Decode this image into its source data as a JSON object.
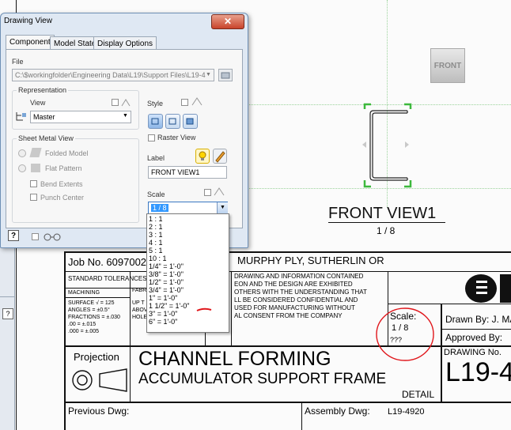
{
  "dialog": {
    "title": "Drawing View",
    "close_label": "✕",
    "tabs": [
      {
        "label": "Component"
      },
      {
        "label": "Model State"
      },
      {
        "label": "Display Options"
      }
    ],
    "file_label": "File",
    "file_path": "C:\\$workingfolder\\Engineering Data\\L19\\Support Files\\L19-4",
    "representation": {
      "group_label": "Representation",
      "view_label": "View",
      "view_value": "Master"
    },
    "sheet_metal": {
      "group_label": "Sheet Metal View",
      "folded": "Folded Model",
      "flat": "Flat Pattern",
      "bend": "Bend Extents",
      "punch": "Punch Center"
    },
    "style_label": "Style",
    "raster_label": "Raster View",
    "label_label": "Label",
    "label_value": "FRONT VIEW1",
    "scale_label": "Scale",
    "scale_value": "1 / 8",
    "help_label": "?",
    "scale_options": [
      "1 : 1",
      "2 : 1",
      "3 : 1",
      "4 : 1",
      "5 : 1",
      "10 : 1",
      "1/4\" = 1'-0\"",
      "3/8\" = 1'-0\"",
      "1/2\" = 1'-0\"",
      "3/4\" = 1'-0\"",
      "1\" = 1'-0\"",
      "1 1/2\" = 1'-0\"",
      "3\" = 1'-0\"",
      "6\" = 1'-0\""
    ]
  },
  "drawing": {
    "front_button": "FRONT",
    "view_title": "FRONT VIEW1",
    "view_scale": "1 / 8",
    "job_no": "Job No. 6097002",
    "company": "MURPHY PLY, SUTHERLIN OR",
    "standard_tol": "STANDARD TOLERANCES",
    "fabr": "FABR",
    "machining": "MACHINING",
    "surface": "SURFACE √ = 125",
    "angles": "ANGLES    = ±0.5°",
    "fractions": "FRACTIONS = ±.030",
    "tol2": ".00        = ±.015",
    "tol3": ".000      = ±.005",
    "up_to": "UP T",
    "abov": "ABOV",
    "hole": "HOLE",
    "confidential": [
      "DRAWING AND INFORMATION CONTAINED",
      "EON AND THE DESIGN ARE EXHIBITED",
      "OTHERS WITH THE UNDERSTANDING THAT",
      "LL BE CONSIDERED CONFIDENTIAL AND",
      "USED FOR MANUFACTURING WITHOUT",
      "AL CONSENT FROM THE COMPANY"
    ],
    "scale_label": "Scale:",
    "scale_value": "1 / 8",
    "scale_unknown": "???",
    "drawn_by": "Drawn By:  J. MA",
    "approved_by": "Approved By:",
    "drawing_no_label": "DRAWING No.",
    "drawing_no": "L19-4",
    "projection": "Projection",
    "title1": "CHANNEL FORMING",
    "title2": "ACCUMULATOR SUPPORT FRAME",
    "detail": "DETAIL",
    "previous_dwg": "Previous Dwg:",
    "assembly_label": "Assembly  Dwg:",
    "assembly_value": "L19-4920"
  },
  "left_panel": {
    "help": "?"
  },
  "colors": {
    "annotation_red": "#e0161b",
    "selection_green": "#3cb93c",
    "dialog_bg": "#dfe8f3"
  }
}
